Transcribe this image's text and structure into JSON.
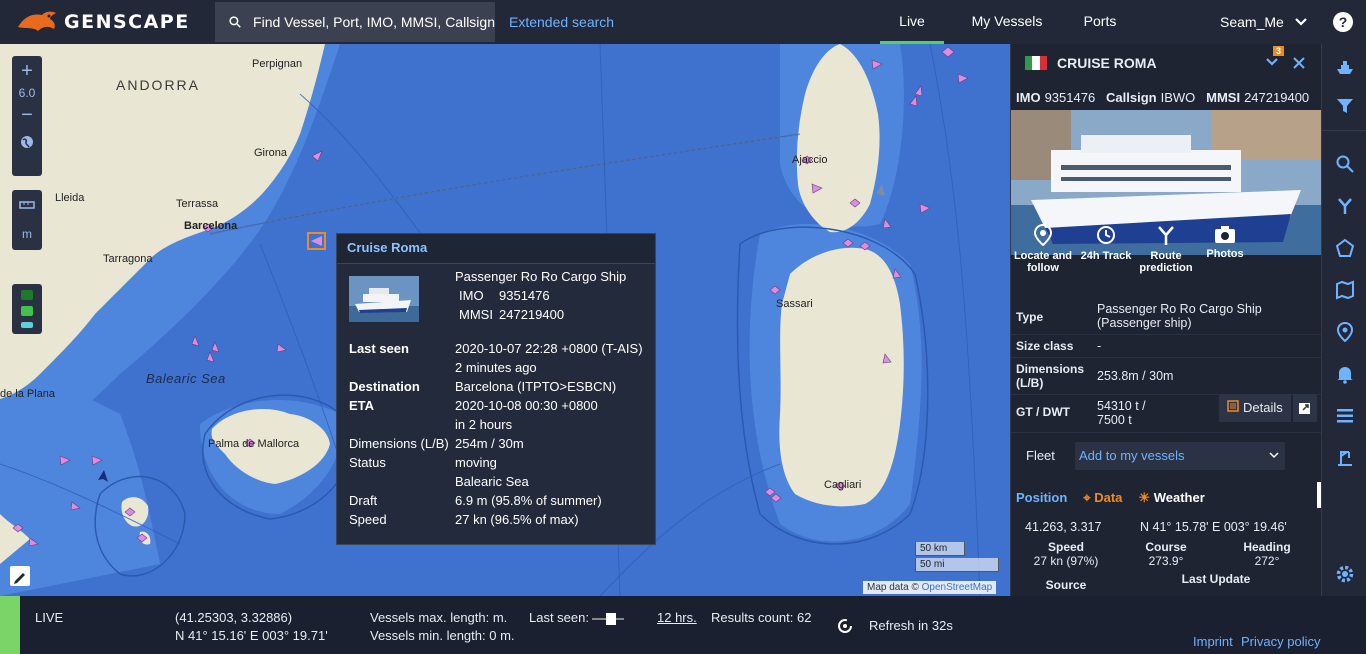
{
  "brand": {
    "name": "GENSCAPE"
  },
  "search": {
    "placeholder": "Find Vessel, Port, IMO, MMSI, Callsign",
    "extended": "Extended search"
  },
  "nav": {
    "items": [
      {
        "label": "Live"
      },
      {
        "label": "My Vessels"
      },
      {
        "label": "Ports"
      }
    ],
    "user": "Seam_Me",
    "help": "?"
  },
  "map": {
    "zoom_in": "+",
    "zoom_level": "6.0",
    "zoom_out": "−",
    "unit": "m",
    "labels": {
      "andorra": "ANDORRA",
      "perpignan": "Perpignan",
      "girona": "Girona",
      "lleida": "Lleida",
      "terrassa": "Terrassa",
      "barcelona": "Barcelona",
      "tarragona": "Tarragona",
      "balearic_sea": "Balearic Sea",
      "de_la_plana": "de la Plana",
      "palma": "Palma de Mallorca",
      "ajaccio": "Ajaccio",
      "sassari": "Sassari",
      "cagliari": "Cagliari"
    },
    "scale": {
      "km": "50 km",
      "mi": "50 mi"
    },
    "attribution_prefix": "Map data ©",
    "attribution_link": "OpenStreetMap"
  },
  "popup": {
    "title": "Cruise Roma",
    "type": "Passenger Ro Ro Cargo Ship",
    "imo_label": "IMO",
    "imo": "9351476",
    "mmsi_label": "MMSI",
    "mmsi": "247219400",
    "last_seen_label": "Last seen",
    "last_seen": "2020-10-07 22:28 +0800 (T-AIS)",
    "last_seen_ago": "2 minutes ago",
    "destination_label": "Destination",
    "destination": "Barcelona (ITPTO>ESBCN)",
    "eta_label": "ETA",
    "eta": "2020-10-08 00:30 +0800",
    "eta_in": "in 2 hours",
    "dimensions_label": "Dimensions (L/B)",
    "dimensions": "254m / 30m",
    "status_label": "Status",
    "status": "moving",
    "status_area": "Balearic Sea",
    "draft_label": "Draft",
    "draft": "6.9 m (95.8% of summer)",
    "speed_label": "Speed",
    "speed": "27 kn (96.5% of max)"
  },
  "panel": {
    "badge": "3",
    "vessel_name": "CRUISE ROMA",
    "imo_label": "IMO",
    "imo": "9351476",
    "callsign_label": "Callsign",
    "callsign": "IBWO",
    "mmsi_label": "MMSI",
    "mmsi": "247219400",
    "actions": {
      "locate": "Locate and follow",
      "track": "24h Track",
      "route": "Route prediction",
      "photos": "Photos"
    },
    "info": {
      "type_label": "Type",
      "type": "Passenger Ro Ro Cargo Ship (Passenger ship)",
      "size_label": "Size class",
      "size": "-",
      "dim_label": "Dimensions (L/B)",
      "dim": "253.8m / 30m",
      "gt_label": "GT / DWT",
      "gt": "54310 t / 7500 t"
    },
    "details": "Details",
    "fleet_label": "Fleet",
    "fleet_select": "Add to my vessels",
    "tabs": {
      "position": "Position",
      "data": "Data",
      "weather": "Weather"
    },
    "coords_dec": "41.263, 3.317",
    "coords_dms": "N 41° 15.78' E 003° 19.46'",
    "speed_label": "Speed",
    "speed": "27 kn (97%)",
    "course_label": "Course",
    "course": "273.9°",
    "heading_label": "Heading",
    "heading": "272°",
    "source_label": "Source",
    "last_update_label": "Last Update"
  },
  "status": {
    "mode": "LIVE",
    "coords_dec": "(41.25303, 3.32886)",
    "coords_dms": "N 41° 15.16' E 003° 19.71'",
    "max_len": "Vessels max. length: m.",
    "min_len": "Vessels min. length: 0 m.",
    "last_seen_label": "Last seen:",
    "last_seen_value": "12 hrs.",
    "results": "Results count: 62",
    "refresh": "Refresh in 32s",
    "imprint": "Imprint",
    "privacy": "Privacy policy"
  },
  "colors": {
    "accent": "#49d36a",
    "link": "#6fb2ff",
    "sea": "#3f72cf",
    "land": "#e9e6d3",
    "vessel": "#d98ee0"
  }
}
